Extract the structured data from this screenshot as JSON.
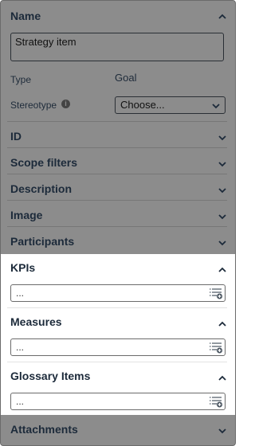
{
  "name_section": {
    "title": "Name",
    "value": "Strategy item"
  },
  "type": {
    "label": "Type",
    "value": "Goal"
  },
  "stereotype": {
    "label": "Stereotype",
    "selected": "Choose..."
  },
  "sections": {
    "id": "ID",
    "scope_filters": "Scope filters",
    "description": "Description",
    "image": "Image",
    "participants": "Participants",
    "kpis": "KPIs",
    "measures": "Measures",
    "glossary_items": "Glossary Items",
    "attachments": "Attachments"
  },
  "placeholders": {
    "kpis": "...",
    "measures": "...",
    "glossary_items": "..."
  },
  "icons": {
    "collapse": "chevron-up-icon",
    "expand": "chevron-down-icon",
    "info": "info-icon",
    "list_add": "list-add-icon"
  },
  "colors": {
    "overlay": "#8c8c8c",
    "highlight": "#ffffff",
    "text": "#1c2a3a"
  }
}
